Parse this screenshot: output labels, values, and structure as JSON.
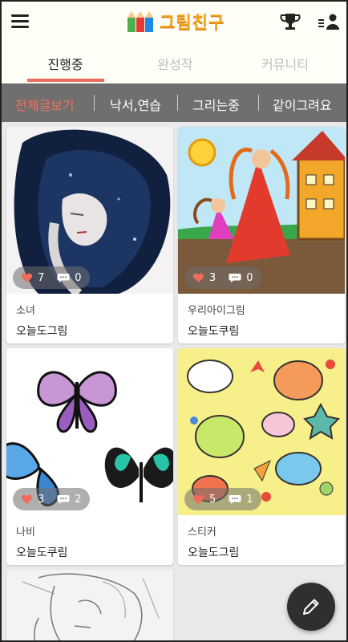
{
  "app": {
    "logo_text": "그림친구"
  },
  "tabs": [
    {
      "label": "진행중"
    },
    {
      "label": "완성작"
    },
    {
      "label": "커뮤니티"
    }
  ],
  "categories": [
    {
      "label": "전체글보기"
    },
    {
      "label": "낙서,연습"
    },
    {
      "label": "그리는중"
    },
    {
      "label": "같이그려요"
    }
  ],
  "posts": [
    {
      "title": "소녀",
      "author": "오늘도그림",
      "likes": "7",
      "comments": "0"
    },
    {
      "title": "우리아이그림",
      "author": "오늘도쿠림",
      "likes": "3",
      "comments": "0"
    },
    {
      "title": "나비",
      "author": "오늘도쿠림",
      "likes": "3",
      "comments": "2"
    },
    {
      "title": "스티커",
      "author": "오늘도그림",
      "likes": "5",
      "comments": "1"
    }
  ],
  "colors": {
    "accent": "#f06b5c",
    "logo": "#f3a21f",
    "catbar": "#6f6f6f"
  }
}
